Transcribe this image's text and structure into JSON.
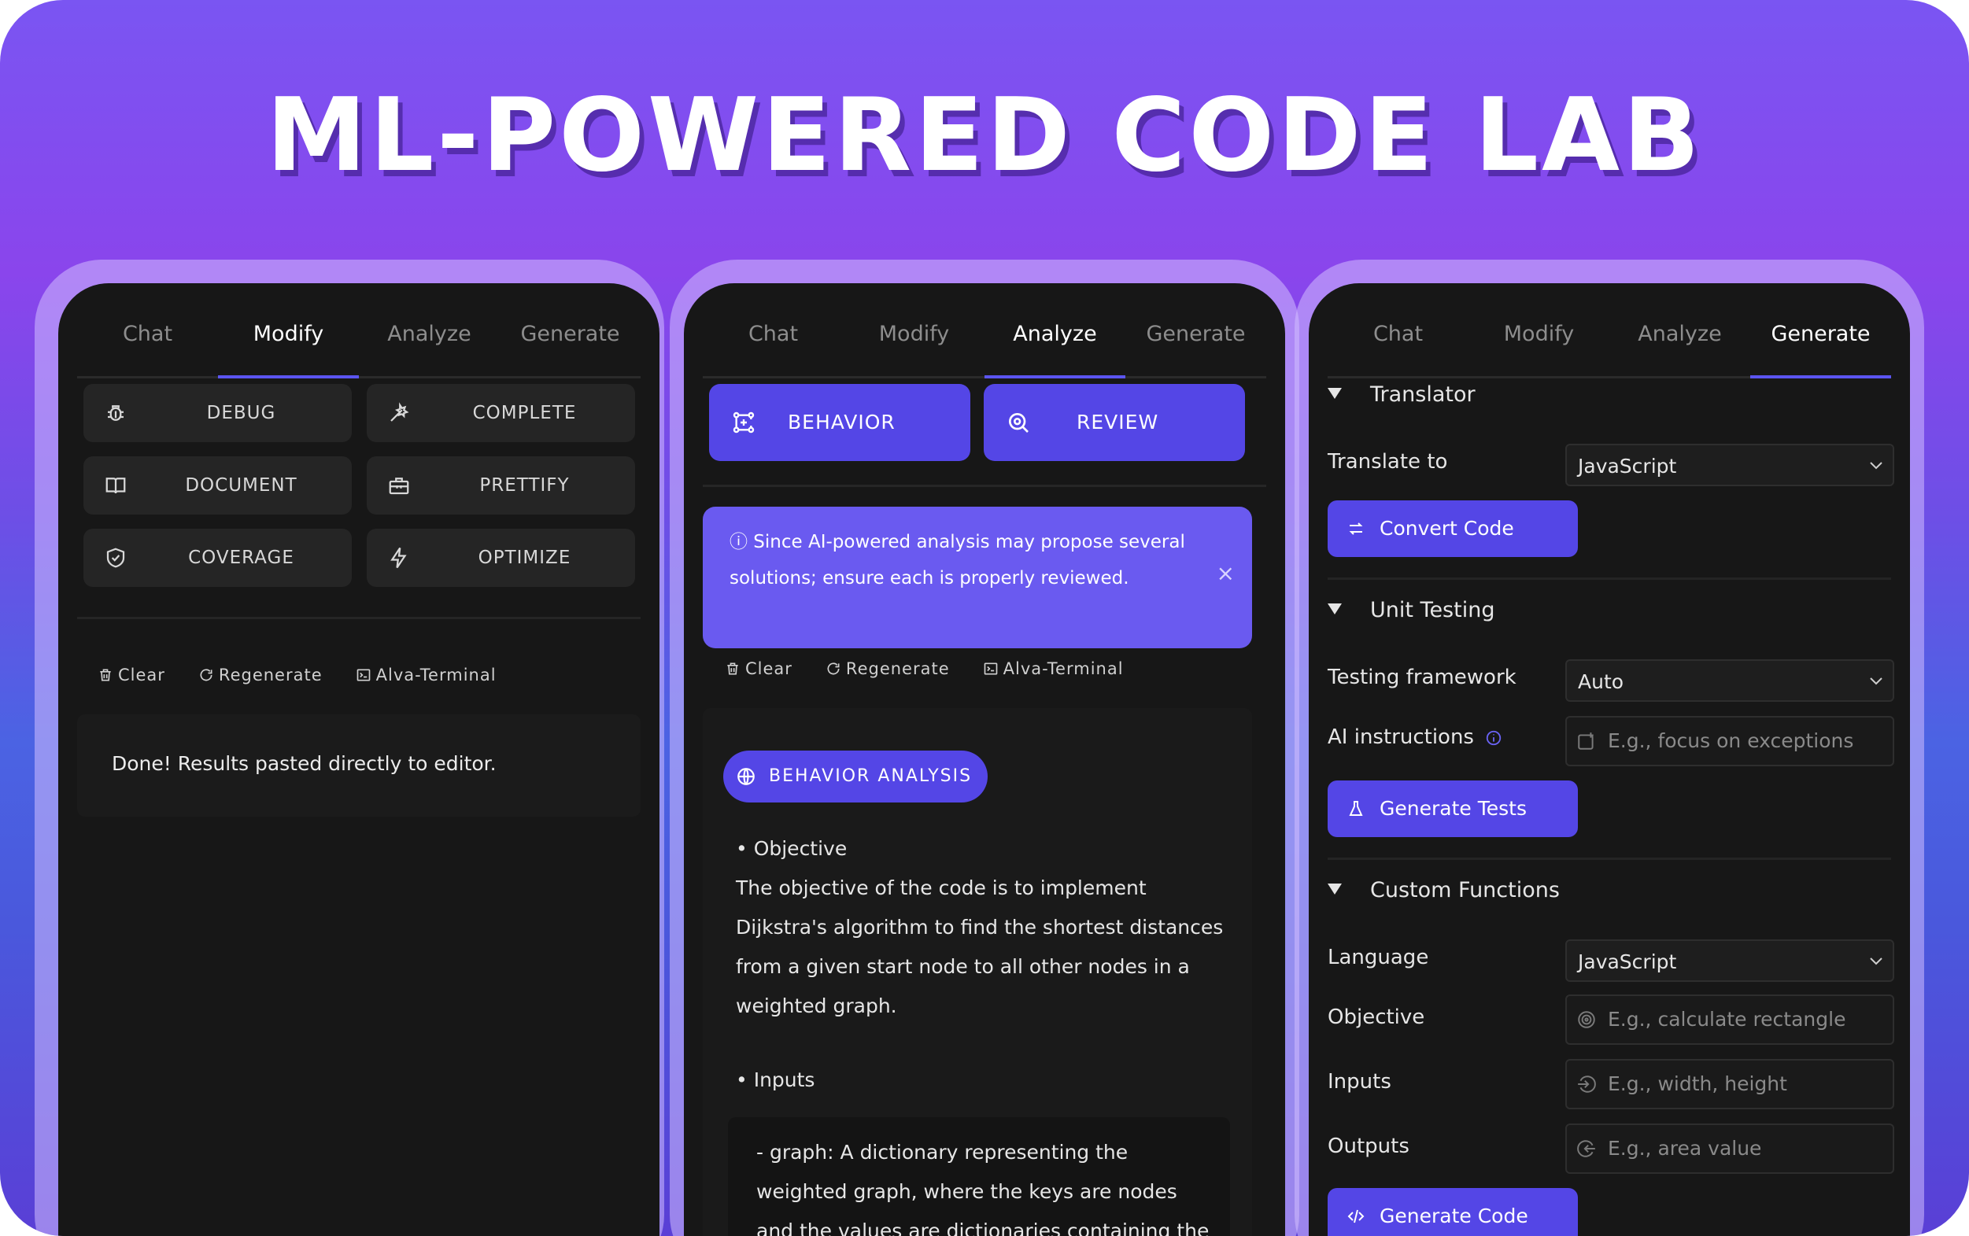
{
  "hero": {
    "title": "ML-POWERED CODE LAB"
  },
  "tabs": [
    "Chat",
    "Modify",
    "Analyze",
    "Generate"
  ],
  "modify_panel": {
    "active_tab": "Modify",
    "buttons": [
      {
        "label": "DEBUG",
        "icon": "bug-icon"
      },
      {
        "label": "COMPLETE",
        "icon": "magic-wand-icon"
      },
      {
        "label": "DOCUMENT",
        "icon": "book-icon"
      },
      {
        "label": "PRETTIFY",
        "icon": "toolbox-icon"
      },
      {
        "label": "COVERAGE",
        "icon": "shield-check-icon"
      },
      {
        "label": "OPTIMIZE",
        "icon": "bolt-icon"
      }
    ],
    "tools": [
      "Clear",
      "Regenerate",
      "Alva-Terminal"
    ],
    "message": "Done! Results pasted directly to editor."
  },
  "analyze_panel": {
    "active_tab": "Analyze",
    "buttons": [
      {
        "label": "BEHAVIOR",
        "icon": "flow-icon"
      },
      {
        "label": "REVIEW",
        "icon": "search-icon"
      }
    ],
    "notice_line1": "ⓘ Since AI-powered analysis may propose several",
    "notice_line2": "solutions; ensure each is properly reviewed.",
    "notice_close": "×",
    "tools": [
      "Clear",
      "Regenerate",
      "Alva-Terminal"
    ],
    "badge": "BEHAVIOR ANALYSIS",
    "objective_head": "• Objective",
    "objective_lines": [
      "The objective of the code is to implement",
      "Dijkstra's algorithm to find the shortest distances",
      "from a given start node to all other nodes in a",
      "weighted graph."
    ],
    "inputs_head": "• Inputs",
    "inputs_lines": [
      "- graph: A dictionary representing the",
      "weighted graph, where the keys are nodes",
      "and the values are dictionaries containing the"
    ]
  },
  "generate_panel": {
    "active_tab": "Generate",
    "translator": {
      "heading": "Translator",
      "translate_label": "Translate to",
      "translate_value": "JavaScript",
      "button": "Convert Code"
    },
    "unit_testing": {
      "heading": "Unit Testing",
      "framework_label": "Testing framework",
      "framework_value": "Auto",
      "instructions_label": "AI instructions",
      "instructions_placeholder": "E.g., focus on exceptions",
      "button": "Generate Tests"
    },
    "custom_functions": {
      "heading": "Custom Functions",
      "language_label": "Language",
      "language_value": "JavaScript",
      "objective_label": "Objective",
      "objective_placeholder": "E.g., calculate rectangle",
      "inputs_label": "Inputs",
      "inputs_placeholder": "E.g., width, height",
      "outputs_label": "Outputs",
      "outputs_placeholder": "E.g., area value",
      "button": "Generate Code"
    }
  },
  "colors": {
    "accent": "#5446e6",
    "panel_bg": "#171717",
    "notice_bg": "#6a5af0"
  }
}
